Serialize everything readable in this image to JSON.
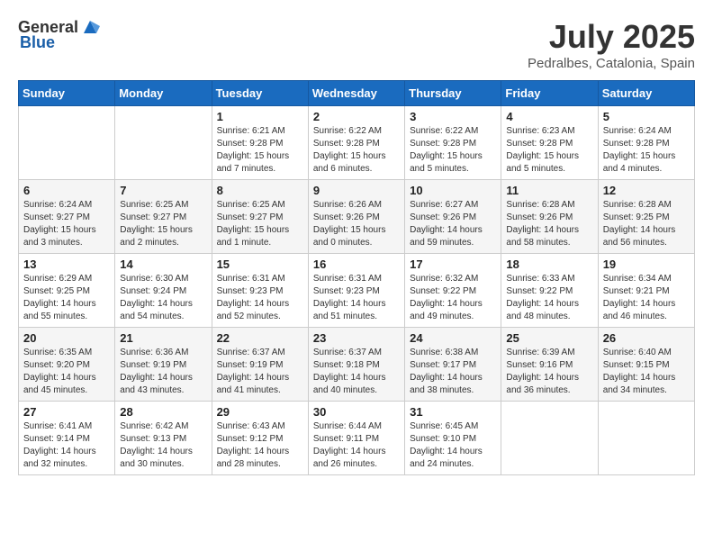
{
  "header": {
    "logo_general": "General",
    "logo_blue": "Blue",
    "month_year": "July 2025",
    "location": "Pedralbes, Catalonia, Spain"
  },
  "calendar": {
    "days_of_week": [
      "Sunday",
      "Monday",
      "Tuesday",
      "Wednesday",
      "Thursday",
      "Friday",
      "Saturday"
    ],
    "weeks": [
      [
        {
          "day": "",
          "info": ""
        },
        {
          "day": "",
          "info": ""
        },
        {
          "day": "1",
          "info": "Sunrise: 6:21 AM\nSunset: 9:28 PM\nDaylight: 15 hours\nand 7 minutes."
        },
        {
          "day": "2",
          "info": "Sunrise: 6:22 AM\nSunset: 9:28 PM\nDaylight: 15 hours\nand 6 minutes."
        },
        {
          "day": "3",
          "info": "Sunrise: 6:22 AM\nSunset: 9:28 PM\nDaylight: 15 hours\nand 5 minutes."
        },
        {
          "day": "4",
          "info": "Sunrise: 6:23 AM\nSunset: 9:28 PM\nDaylight: 15 hours\nand 5 minutes."
        },
        {
          "day": "5",
          "info": "Sunrise: 6:24 AM\nSunset: 9:28 PM\nDaylight: 15 hours\nand 4 minutes."
        }
      ],
      [
        {
          "day": "6",
          "info": "Sunrise: 6:24 AM\nSunset: 9:27 PM\nDaylight: 15 hours\nand 3 minutes."
        },
        {
          "day": "7",
          "info": "Sunrise: 6:25 AM\nSunset: 9:27 PM\nDaylight: 15 hours\nand 2 minutes."
        },
        {
          "day": "8",
          "info": "Sunrise: 6:25 AM\nSunset: 9:27 PM\nDaylight: 15 hours\nand 1 minute."
        },
        {
          "day": "9",
          "info": "Sunrise: 6:26 AM\nSunset: 9:26 PM\nDaylight: 15 hours\nand 0 minutes."
        },
        {
          "day": "10",
          "info": "Sunrise: 6:27 AM\nSunset: 9:26 PM\nDaylight: 14 hours\nand 59 minutes."
        },
        {
          "day": "11",
          "info": "Sunrise: 6:28 AM\nSunset: 9:26 PM\nDaylight: 14 hours\nand 58 minutes."
        },
        {
          "day": "12",
          "info": "Sunrise: 6:28 AM\nSunset: 9:25 PM\nDaylight: 14 hours\nand 56 minutes."
        }
      ],
      [
        {
          "day": "13",
          "info": "Sunrise: 6:29 AM\nSunset: 9:25 PM\nDaylight: 14 hours\nand 55 minutes."
        },
        {
          "day": "14",
          "info": "Sunrise: 6:30 AM\nSunset: 9:24 PM\nDaylight: 14 hours\nand 54 minutes."
        },
        {
          "day": "15",
          "info": "Sunrise: 6:31 AM\nSunset: 9:23 PM\nDaylight: 14 hours\nand 52 minutes."
        },
        {
          "day": "16",
          "info": "Sunrise: 6:31 AM\nSunset: 9:23 PM\nDaylight: 14 hours\nand 51 minutes."
        },
        {
          "day": "17",
          "info": "Sunrise: 6:32 AM\nSunset: 9:22 PM\nDaylight: 14 hours\nand 49 minutes."
        },
        {
          "day": "18",
          "info": "Sunrise: 6:33 AM\nSunset: 9:22 PM\nDaylight: 14 hours\nand 48 minutes."
        },
        {
          "day": "19",
          "info": "Sunrise: 6:34 AM\nSunset: 9:21 PM\nDaylight: 14 hours\nand 46 minutes."
        }
      ],
      [
        {
          "day": "20",
          "info": "Sunrise: 6:35 AM\nSunset: 9:20 PM\nDaylight: 14 hours\nand 45 minutes."
        },
        {
          "day": "21",
          "info": "Sunrise: 6:36 AM\nSunset: 9:19 PM\nDaylight: 14 hours\nand 43 minutes."
        },
        {
          "day": "22",
          "info": "Sunrise: 6:37 AM\nSunset: 9:19 PM\nDaylight: 14 hours\nand 41 minutes."
        },
        {
          "day": "23",
          "info": "Sunrise: 6:37 AM\nSunset: 9:18 PM\nDaylight: 14 hours\nand 40 minutes."
        },
        {
          "day": "24",
          "info": "Sunrise: 6:38 AM\nSunset: 9:17 PM\nDaylight: 14 hours\nand 38 minutes."
        },
        {
          "day": "25",
          "info": "Sunrise: 6:39 AM\nSunset: 9:16 PM\nDaylight: 14 hours\nand 36 minutes."
        },
        {
          "day": "26",
          "info": "Sunrise: 6:40 AM\nSunset: 9:15 PM\nDaylight: 14 hours\nand 34 minutes."
        }
      ],
      [
        {
          "day": "27",
          "info": "Sunrise: 6:41 AM\nSunset: 9:14 PM\nDaylight: 14 hours\nand 32 minutes."
        },
        {
          "day": "28",
          "info": "Sunrise: 6:42 AM\nSunset: 9:13 PM\nDaylight: 14 hours\nand 30 minutes."
        },
        {
          "day": "29",
          "info": "Sunrise: 6:43 AM\nSunset: 9:12 PM\nDaylight: 14 hours\nand 28 minutes."
        },
        {
          "day": "30",
          "info": "Sunrise: 6:44 AM\nSunset: 9:11 PM\nDaylight: 14 hours\nand 26 minutes."
        },
        {
          "day": "31",
          "info": "Sunrise: 6:45 AM\nSunset: 9:10 PM\nDaylight: 14 hours\nand 24 minutes."
        },
        {
          "day": "",
          "info": ""
        },
        {
          "day": "",
          "info": ""
        }
      ]
    ]
  }
}
